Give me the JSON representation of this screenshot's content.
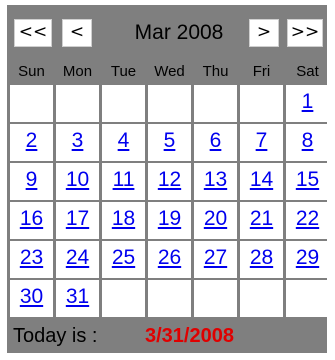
{
  "nav": {
    "prev_year_label": "<<",
    "prev_month_label": "<",
    "title": "Mar 2008",
    "next_month_label": ">",
    "next_year_label": ">>"
  },
  "weekdays": [
    "Sun",
    "Mon",
    "Tue",
    "Wed",
    "Thu",
    "Fri",
    "Sat"
  ],
  "weeks": [
    [
      "",
      "",
      "",
      "",
      "",
      "",
      "1"
    ],
    [
      "2",
      "3",
      "4",
      "5",
      "6",
      "7",
      "8"
    ],
    [
      "9",
      "10",
      "11",
      "12",
      "13",
      "14",
      "15"
    ],
    [
      "16",
      "17",
      "18",
      "19",
      "20",
      "21",
      "22"
    ],
    [
      "23",
      "24",
      "25",
      "26",
      "27",
      "28",
      "29"
    ],
    [
      "30",
      "31",
      "",
      "",
      "",
      "",
      ""
    ]
  ],
  "footer": {
    "label": "Today is :",
    "date": "3/31/2008"
  },
  "colors": {
    "frame": "#7f7f7f",
    "day_link": "#0000ee",
    "today_date": "#e00000"
  }
}
